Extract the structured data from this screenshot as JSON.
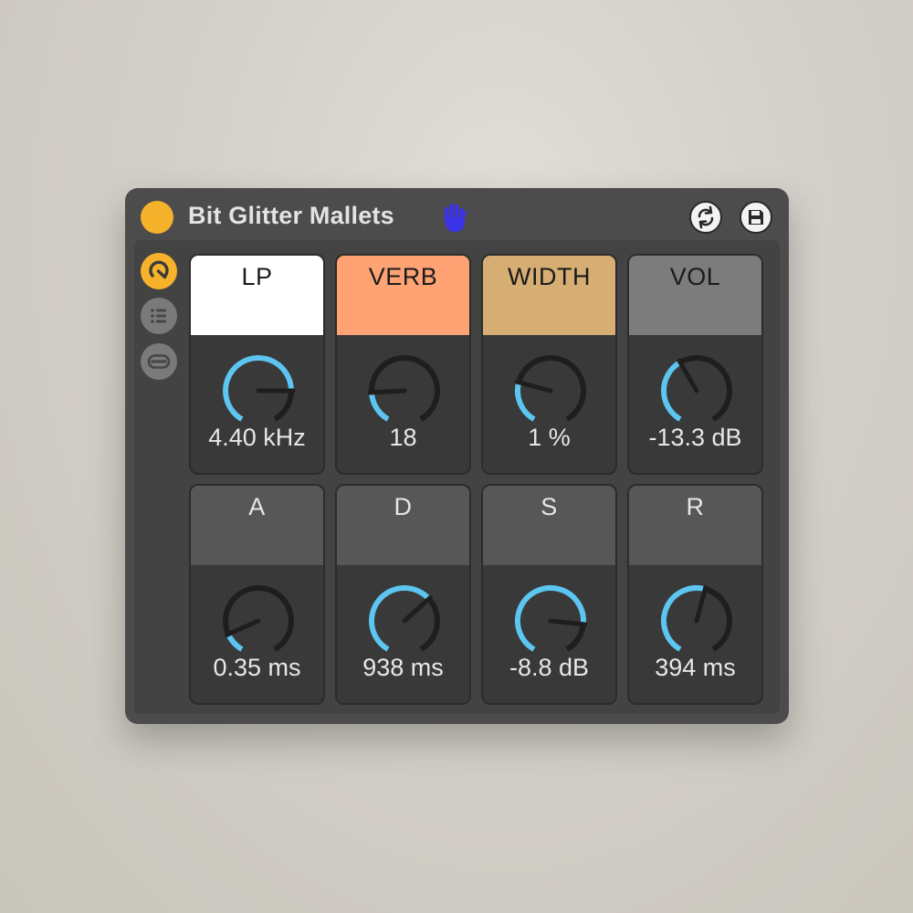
{
  "device": {
    "title": "Bit Glitter Mallets",
    "power_color": "#f7b22b",
    "hand_icon": "hand-icon",
    "refresh_icon": "refresh-icon",
    "save_icon": "save-icon"
  },
  "sidebar": {
    "items": [
      {
        "icon": "macro-knob-icon",
        "active": true
      },
      {
        "icon": "list-icon",
        "active": false
      },
      {
        "icon": "minimize-icon",
        "active": false
      }
    ]
  },
  "macros": [
    {
      "label": "LP",
      "value": "4.40 kHz",
      "level": 0.8,
      "head_color": "#ffffff"
    },
    {
      "label": "VERB",
      "value": "18",
      "level": 0.19,
      "head_color": "#ffa374"
    },
    {
      "label": "WIDTH",
      "value": "1 %",
      "level": 0.25,
      "head_color": "#d6ae73"
    },
    {
      "label": "VOL",
      "value": "-13.3 dB",
      "level": 0.4,
      "head_color": "#7d7c7d"
    },
    {
      "label": "A",
      "value": "0.35 ms",
      "level": 0.12,
      "head_color": "#575757"
    },
    {
      "label": "D",
      "value": "938 ms",
      "level": 0.66,
      "head_color": "#575757"
    },
    {
      "label": "S",
      "value": "-8.8 dB",
      "level": 0.82,
      "head_color": "#575757"
    },
    {
      "label": "R",
      "value": "394 ms",
      "level": 0.55,
      "head_color": "#575757"
    }
  ],
  "colors": {
    "knob_arc": "#5cc5f0",
    "knob_track": "#1e1e1e",
    "knob_needle": "#1e1e1e"
  }
}
